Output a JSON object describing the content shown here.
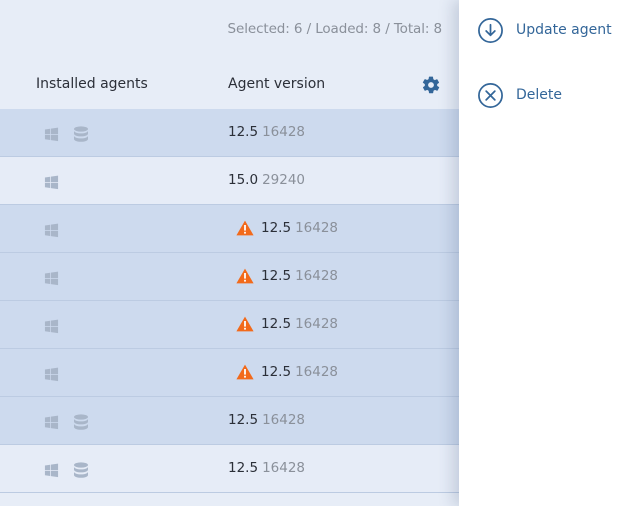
{
  "status": {
    "text": "Selected: 6 / Loaded: 8 / Total: 8"
  },
  "columns": {
    "installed_agents": "Installed agents",
    "agent_version": "Agent version"
  },
  "icons": {
    "settings": "gear-icon",
    "os": "windows-icon",
    "database": "database-icon",
    "warning": "warning-icon",
    "update": "download-circle-icon",
    "delete": "close-circle-icon"
  },
  "colors": {
    "accent": "#336699",
    "warning": "#f26a1b",
    "selected_row": "#cddaee",
    "unselected_row": "#e6ecf7"
  },
  "rows": [
    {
      "selected": true,
      "windows": true,
      "database": true,
      "warning": false,
      "version": "12.5",
      "build": "16428"
    },
    {
      "selected": false,
      "windows": true,
      "database": false,
      "warning": false,
      "version": "15.0",
      "build": "29240"
    },
    {
      "selected": true,
      "windows": true,
      "database": false,
      "warning": true,
      "version": "12.5",
      "build": "16428"
    },
    {
      "selected": true,
      "windows": true,
      "database": false,
      "warning": true,
      "version": "12.5",
      "build": "16428"
    },
    {
      "selected": true,
      "windows": true,
      "database": false,
      "warning": true,
      "version": "12.5",
      "build": "16428"
    },
    {
      "selected": true,
      "windows": true,
      "database": false,
      "warning": true,
      "version": "12.5",
      "build": "16428"
    },
    {
      "selected": true,
      "windows": true,
      "database": true,
      "warning": false,
      "version": "12.5",
      "build": "16428"
    },
    {
      "selected": false,
      "windows": true,
      "database": true,
      "warning": false,
      "version": "12.5",
      "build": "16428"
    }
  ],
  "actions": {
    "update_agent": "Update agent",
    "delete": "Delete"
  }
}
